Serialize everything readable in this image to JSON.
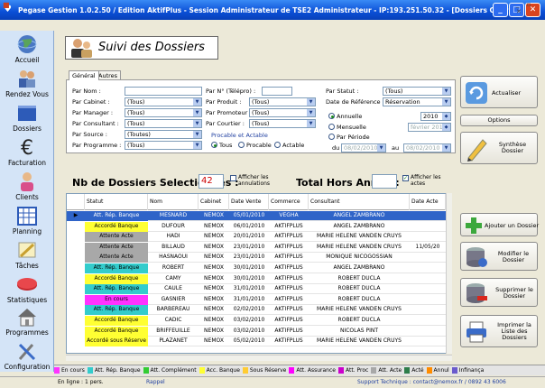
{
  "window": {
    "title": "Pegase Gestion 1.0.2.50 / Edition AktifPlus - Session Administrateur de TSE2 Administrateur - IP:193.251.50.32 - [Dossiers Clients]",
    "min": "_",
    "max": "□",
    "close": "✕"
  },
  "menu": {
    "mdi": "_ ▫ ✕"
  },
  "nav": [
    {
      "label": "Accueil",
      "icon": "globe-icon"
    },
    {
      "label": "Rendez Vous",
      "icon": "people-icon"
    },
    {
      "label": "Dossiers",
      "icon": "folders-icon"
    },
    {
      "label": "Facturation",
      "icon": "euro-icon"
    },
    {
      "label": "Clients",
      "icon": "client-icon"
    },
    {
      "label": "Planning",
      "icon": "calendar-icon"
    },
    {
      "label": "Tâches",
      "icon": "tasks-icon"
    },
    {
      "label": "Statistiques",
      "icon": "stats-icon"
    },
    {
      "label": "Programmes",
      "icon": "home-icon"
    },
    {
      "label": "Configuration",
      "icon": "tools-icon"
    }
  ],
  "panel": {
    "title": "Suivi des Dossiers"
  },
  "tabs": {
    "general": "Général",
    "autres": "Autres"
  },
  "filters": {
    "nom_label": "Par Nom :",
    "cabinet_label": "Par Cabinet :",
    "cabinet_value": "(Tous)",
    "manager_label": "Par Manager :",
    "manager_value": "(Tous)",
    "consultant_label": "Par Consultant :",
    "consultant_value": "(Tous)",
    "source_label": "Par Source :",
    "source_value": "(Toutes)",
    "programme_label": "Par Programme :",
    "programme_value": "(Tous)",
    "tel_label": "Par N° (Télépro) :",
    "produit_label": "Par Produit :",
    "produit_value": "(Tous)",
    "promoteur_label": "Par Promoteur :",
    "promoteur_value": "(Tous)",
    "courtier_label": "Par Courtier :",
    "courtier_value": "(Tous)",
    "procable_group": "Procable et Actable",
    "procable_opts": [
      "Tous",
      "Procable",
      "Actable"
    ],
    "statut_label": "Par Statut :",
    "statut_value": "(Tous)",
    "dateref_label": "Date de Référence :",
    "dateref_value": "Réservation",
    "annuelle": "Annuelle",
    "year_value": "2010",
    "mensuelle": "Mensuelle",
    "month_value": "février 2010",
    "periode": "Par Période",
    "du": "du",
    "du_value": "08/02/2010",
    "au": "au",
    "au_value": "08/02/2010"
  },
  "actions": {
    "actualiser": "Actualiser",
    "options": "Options",
    "synthese": "Synthèse Dossier",
    "ajouter": "Ajouter un Dossier",
    "modifier": "Modifier le Dossier",
    "supprimer": "Supprimer le Dossier",
    "imprimer": "Imprimer la Liste des Dossiers"
  },
  "counts": {
    "nb_label": "Nb de Dossiers Selectionnés :",
    "nb_value": "42",
    "afficher_annul": "Afficher les annulations",
    "total_label": "Total Hors Annul. :",
    "afficher_actes": "Afficher les actes"
  },
  "table": {
    "columns": [
      "Statut",
      "Nom",
      "Cabinet",
      "Date Vente",
      "Commerce",
      "Consultant",
      "Date Acte"
    ],
    "rows": [
      {
        "statut": "Att. Rép. Banque",
        "color": "#2f64c8",
        "nom": "MESNARD",
        "cabinet": "NEMOX",
        "date": "05/01/2010",
        "commerce": "VEGHA",
        "consultant": "ANGEL ZAMBRANO",
        "acte": ""
      },
      {
        "statut": "Accordé Banque",
        "color": "#ffff33",
        "nom": "DUFOUR",
        "cabinet": "NEMOX",
        "date": "06/01/2010",
        "commerce": "AKTIFPLUS",
        "consultant": "ANGEL ZAMBRANO",
        "acte": ""
      },
      {
        "statut": "Attente Acte",
        "color": "#a8a8a8",
        "nom": "HADI",
        "cabinet": "NEMOX",
        "date": "20/01/2010",
        "commerce": "AKTIFPLUS",
        "consultant": "MARIE HELENE VANDEN CRUYS",
        "acte": ""
      },
      {
        "statut": "Attente Acte",
        "color": "#a8a8a8",
        "nom": "BILLAUD",
        "cabinet": "NEMOX",
        "date": "23/01/2010",
        "commerce": "AKTIFPLUS",
        "consultant": "MARIE HELENE VANDEN CRUYS",
        "acte": "11/05/20"
      },
      {
        "statut": "Attente Acte",
        "color": "#a8a8a8",
        "nom": "HASNAOUI",
        "cabinet": "NEMOX",
        "date": "23/01/2010",
        "commerce": "AKTIFPLUS",
        "consultant": "MONIQUE NICOGOSSIAN",
        "acte": ""
      },
      {
        "statut": "Att. Rép. Banque",
        "color": "#33cccc",
        "nom": "ROBERT",
        "cabinet": "NEMOX",
        "date": "30/01/2010",
        "commerce": "AKTIFPLUS",
        "consultant": "ANGEL ZAMBRANO",
        "acte": ""
      },
      {
        "statut": "Accordé Banque",
        "color": "#ffff33",
        "nom": "CAMY",
        "cabinet": "NEMOX",
        "date": "30/01/2010",
        "commerce": "AKTIFPLUS",
        "consultant": "ROBERT DUCLA",
        "acte": ""
      },
      {
        "statut": "Att. Rép. Banque",
        "color": "#33cccc",
        "nom": "CAULE",
        "cabinet": "NEMOX",
        "date": "31/01/2010",
        "commerce": "AKTIFPLUS",
        "consultant": "ROBERT DUCLA",
        "acte": ""
      },
      {
        "statut": "En cours",
        "color": "#ff33ff",
        "nom": "GASNIER",
        "cabinet": "NEMOX",
        "date": "31/01/2010",
        "commerce": "AKTIFPLUS",
        "consultant": "ROBERT DUCLA",
        "acte": ""
      },
      {
        "statut": "Att. Rép. Banque",
        "color": "#33cccc",
        "nom": "BARBEREAU",
        "cabinet": "NEMOX",
        "date": "02/02/2010",
        "commerce": "AKTIFPLUS",
        "consultant": "MARIE HELENE VANDEN CRUYS",
        "acte": ""
      },
      {
        "statut": "Accordé Banque",
        "color": "#ffff33",
        "nom": "CADIC",
        "cabinet": "NEMOX",
        "date": "03/02/2010",
        "commerce": "AKTIFPLUS",
        "consultant": "ROBERT DUCLA",
        "acte": ""
      },
      {
        "statut": "Accordé Banque",
        "color": "#ffff33",
        "nom": "BRIFFEUILLE",
        "cabinet": "NEMOX",
        "date": "03/02/2010",
        "commerce": "AKTIFPLUS",
        "consultant": "NICOLAS PINT",
        "acte": ""
      },
      {
        "statut": "Accordé sous Réserve",
        "color": "#ffff33",
        "nom": "PLAZANET",
        "cabinet": "NEMOX",
        "date": "05/02/2010",
        "commerce": "AKTIFPLUS",
        "consultant": "MARIE HELENE VANDEN CRUYS",
        "acte": ""
      }
    ]
  },
  "legend": [
    {
      "label": "En cours",
      "color": "#ff33ff"
    },
    {
      "label": "Att. Rép. Banque",
      "color": "#33cccc"
    },
    {
      "label": "Att. Complément",
      "color": "#33cc33"
    },
    {
      "label": "Acc. Banque",
      "color": "#ffff33"
    },
    {
      "label": "Sous Réserve",
      "color": "#ffcc33"
    },
    {
      "label": "Att. Assurance",
      "color": "#ff00ff"
    },
    {
      "label": "Att. Proc",
      "color": "#cc00cc"
    },
    {
      "label": "Att. Acte",
      "color": "#a8a8a8"
    },
    {
      "label": "Acté",
      "color": "#2e7d4a"
    },
    {
      "label": "Annul",
      "color": "#ff8c00"
    },
    {
      "label": "Infinança",
      "color": "#6a5acd"
    }
  ],
  "status": {
    "online": "En ligne : 1 pers.",
    "rappel": "Rappel",
    "support": "Support Technique : contact@nemox.fr / 0892 43 6006"
  }
}
